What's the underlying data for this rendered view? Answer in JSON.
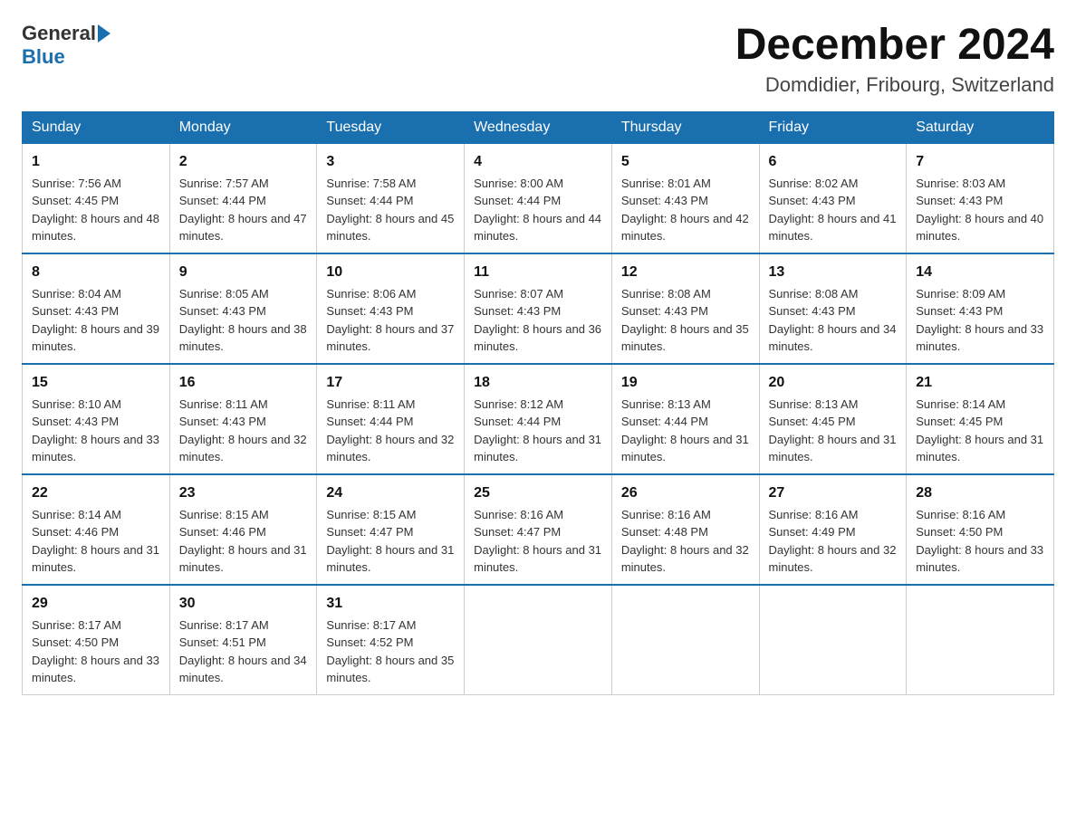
{
  "header": {
    "logo_general": "General",
    "logo_blue": "Blue",
    "month_title": "December 2024",
    "location": "Domdidier, Fribourg, Switzerland"
  },
  "weekdays": [
    "Sunday",
    "Monday",
    "Tuesday",
    "Wednesday",
    "Thursday",
    "Friday",
    "Saturday"
  ],
  "weeks": [
    [
      {
        "day": "1",
        "sunrise": "7:56 AM",
        "sunset": "4:45 PM",
        "daylight": "8 hours and 48 minutes."
      },
      {
        "day": "2",
        "sunrise": "7:57 AM",
        "sunset": "4:44 PM",
        "daylight": "8 hours and 47 minutes."
      },
      {
        "day": "3",
        "sunrise": "7:58 AM",
        "sunset": "4:44 PM",
        "daylight": "8 hours and 45 minutes."
      },
      {
        "day": "4",
        "sunrise": "8:00 AM",
        "sunset": "4:44 PM",
        "daylight": "8 hours and 44 minutes."
      },
      {
        "day": "5",
        "sunrise": "8:01 AM",
        "sunset": "4:43 PM",
        "daylight": "8 hours and 42 minutes."
      },
      {
        "day": "6",
        "sunrise": "8:02 AM",
        "sunset": "4:43 PM",
        "daylight": "8 hours and 41 minutes."
      },
      {
        "day": "7",
        "sunrise": "8:03 AM",
        "sunset": "4:43 PM",
        "daylight": "8 hours and 40 minutes."
      }
    ],
    [
      {
        "day": "8",
        "sunrise": "8:04 AM",
        "sunset": "4:43 PM",
        "daylight": "8 hours and 39 minutes."
      },
      {
        "day": "9",
        "sunrise": "8:05 AM",
        "sunset": "4:43 PM",
        "daylight": "8 hours and 38 minutes."
      },
      {
        "day": "10",
        "sunrise": "8:06 AM",
        "sunset": "4:43 PM",
        "daylight": "8 hours and 37 minutes."
      },
      {
        "day": "11",
        "sunrise": "8:07 AM",
        "sunset": "4:43 PM",
        "daylight": "8 hours and 36 minutes."
      },
      {
        "day": "12",
        "sunrise": "8:08 AM",
        "sunset": "4:43 PM",
        "daylight": "8 hours and 35 minutes."
      },
      {
        "day": "13",
        "sunrise": "8:08 AM",
        "sunset": "4:43 PM",
        "daylight": "8 hours and 34 minutes."
      },
      {
        "day": "14",
        "sunrise": "8:09 AM",
        "sunset": "4:43 PM",
        "daylight": "8 hours and 33 minutes."
      }
    ],
    [
      {
        "day": "15",
        "sunrise": "8:10 AM",
        "sunset": "4:43 PM",
        "daylight": "8 hours and 33 minutes."
      },
      {
        "day": "16",
        "sunrise": "8:11 AM",
        "sunset": "4:43 PM",
        "daylight": "8 hours and 32 minutes."
      },
      {
        "day": "17",
        "sunrise": "8:11 AM",
        "sunset": "4:44 PM",
        "daylight": "8 hours and 32 minutes."
      },
      {
        "day": "18",
        "sunrise": "8:12 AM",
        "sunset": "4:44 PM",
        "daylight": "8 hours and 31 minutes."
      },
      {
        "day": "19",
        "sunrise": "8:13 AM",
        "sunset": "4:44 PM",
        "daylight": "8 hours and 31 minutes."
      },
      {
        "day": "20",
        "sunrise": "8:13 AM",
        "sunset": "4:45 PM",
        "daylight": "8 hours and 31 minutes."
      },
      {
        "day": "21",
        "sunrise": "8:14 AM",
        "sunset": "4:45 PM",
        "daylight": "8 hours and 31 minutes."
      }
    ],
    [
      {
        "day": "22",
        "sunrise": "8:14 AM",
        "sunset": "4:46 PM",
        "daylight": "8 hours and 31 minutes."
      },
      {
        "day": "23",
        "sunrise": "8:15 AM",
        "sunset": "4:46 PM",
        "daylight": "8 hours and 31 minutes."
      },
      {
        "day": "24",
        "sunrise": "8:15 AM",
        "sunset": "4:47 PM",
        "daylight": "8 hours and 31 minutes."
      },
      {
        "day": "25",
        "sunrise": "8:16 AM",
        "sunset": "4:47 PM",
        "daylight": "8 hours and 31 minutes."
      },
      {
        "day": "26",
        "sunrise": "8:16 AM",
        "sunset": "4:48 PM",
        "daylight": "8 hours and 32 minutes."
      },
      {
        "day": "27",
        "sunrise": "8:16 AM",
        "sunset": "4:49 PM",
        "daylight": "8 hours and 32 minutes."
      },
      {
        "day": "28",
        "sunrise": "8:16 AM",
        "sunset": "4:50 PM",
        "daylight": "8 hours and 33 minutes."
      }
    ],
    [
      {
        "day": "29",
        "sunrise": "8:17 AM",
        "sunset": "4:50 PM",
        "daylight": "8 hours and 33 minutes."
      },
      {
        "day": "30",
        "sunrise": "8:17 AM",
        "sunset": "4:51 PM",
        "daylight": "8 hours and 34 minutes."
      },
      {
        "day": "31",
        "sunrise": "8:17 AM",
        "sunset": "4:52 PM",
        "daylight": "8 hours and 35 minutes."
      },
      null,
      null,
      null,
      null
    ]
  ]
}
